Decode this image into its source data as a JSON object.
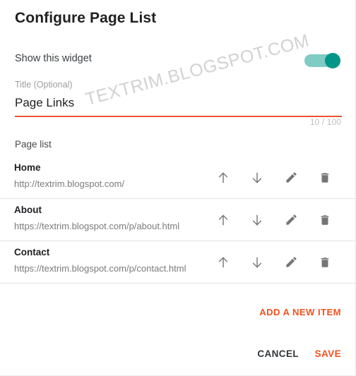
{
  "dialog": {
    "title": "Configure Page List",
    "watermark": "TEXTRIM.BLOGSPOT.COM"
  },
  "toggle": {
    "label": "Show this widget",
    "state": "on",
    "track_color": "#80cbc4",
    "thumb_color": "#009688"
  },
  "title_field": {
    "label": "Title (Optional)",
    "value": "Page Links",
    "placeholder": "Title (Optional)",
    "counter": "10 / 100",
    "underline_color": "#e8542f"
  },
  "page_list": {
    "label": "Page list",
    "items": [
      {
        "title": "Home",
        "url": "http://textrim.blogspot.com/"
      },
      {
        "title": "About",
        "url": "https://textrim.blogspot.com/p/about.html"
      },
      {
        "title": "Contact",
        "url": "https://textrim.blogspot.com/p/contact.html"
      }
    ],
    "actions": [
      {
        "icon": "arrow-up-icon",
        "name": "move-up"
      },
      {
        "icon": "arrow-down-icon",
        "name": "move-down"
      },
      {
        "icon": "pencil-icon",
        "name": "edit"
      },
      {
        "icon": "trash-icon",
        "name": "delete"
      }
    ]
  },
  "footer": {
    "add_item_label": "ADD A NEW ITEM",
    "cancel_label": "CANCEL",
    "save_label": "SAVE",
    "accent_color": "#f4501e"
  }
}
